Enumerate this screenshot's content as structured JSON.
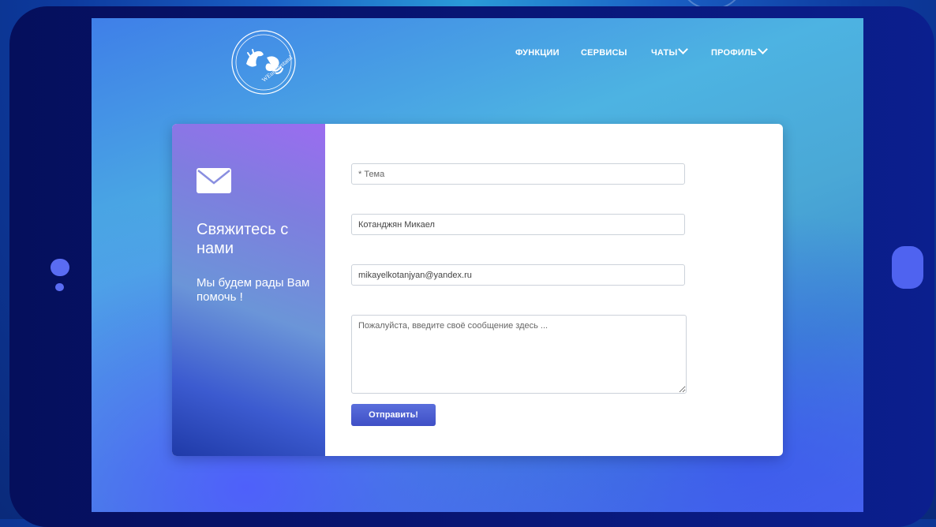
{
  "logo": {
    "text": "WEunderstand",
    "icon": "hands-sign-language-icon"
  },
  "nav": {
    "items": [
      {
        "label": "ФУНКЦИИ",
        "dropdown": false
      },
      {
        "label": "СЕРВИСЫ",
        "dropdown": false
      },
      {
        "label": "ЧАТЫ",
        "dropdown": true
      },
      {
        "label": "ПРОФИЛЬ",
        "dropdown": true
      }
    ]
  },
  "contact": {
    "icon": "envelope-icon",
    "title": "Свяжитесь с нами",
    "subtitle": "Мы будем рады Вам помочь !"
  },
  "form": {
    "subject_placeholder": "* Тема",
    "name_value": "Котанджян Микаел",
    "email_value": "mikayelkotanjyan@yandex.ru",
    "message_placeholder": "Пожалуйста, введите своё сообщение здесь ...",
    "submit_label": "Отправить!"
  },
  "colors": {
    "tablet_frame": "#071470",
    "accent_button": "#3f4fc6",
    "home_button": "#4f63f0"
  }
}
